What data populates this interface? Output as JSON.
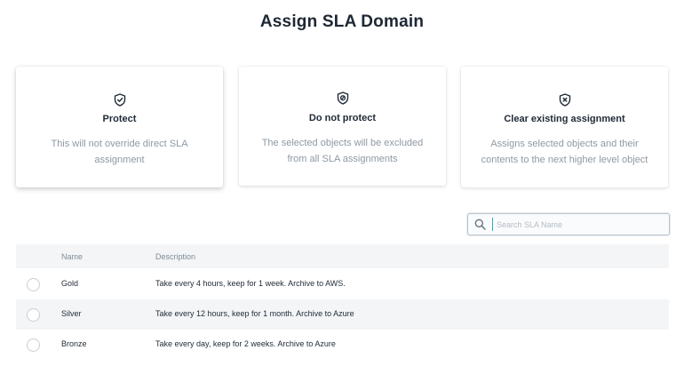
{
  "dialog": {
    "title": "Assign SLA Domain"
  },
  "options": [
    {
      "title": "Protect",
      "description": "This will not override direct SLA assignment",
      "icon": "shield-check-icon"
    },
    {
      "title": "Do not protect",
      "description": "The selected objects will be excluded from all SLA assignments",
      "icon": "shield-circle-icon"
    },
    {
      "title": "Clear existing assignment",
      "description": "Assigns selected objects and their contents to the next higher level object",
      "icon": "shield-x-icon"
    }
  ],
  "search": {
    "placeholder": "Search SLA Name",
    "value": "",
    "icon": "search-icon"
  },
  "table": {
    "columns": [
      "Name",
      "Description"
    ],
    "rows": [
      {
        "name": "Gold",
        "description": "Take every 4 hours, keep for 1 week. Archive to AWS."
      },
      {
        "name": "Silver",
        "description": "Take every 12 hours, keep for 1 month. Archive to Azure"
      },
      {
        "name": "Bronze",
        "description": "Take every day, keep for 2 weeks. Archive to Azure"
      }
    ]
  },
  "colors": {
    "accent": "#2aa8c8",
    "text": "#1f2a36",
    "muted": "#8e99a4",
    "stripe": "#f3f5f7"
  }
}
